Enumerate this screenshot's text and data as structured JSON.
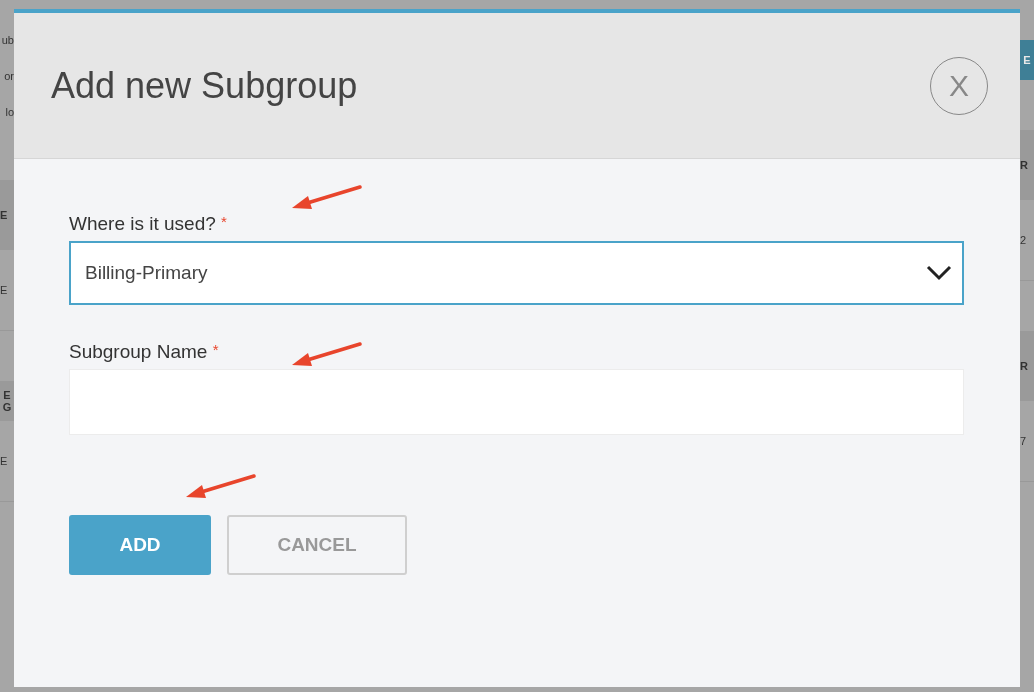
{
  "background": {
    "left_fragments": [
      {
        "text": "ub",
        "kind": "line"
      },
      {
        "text": "or",
        "kind": "line"
      },
      {
        "text": "lo",
        "kind": "line"
      },
      {
        "text": "E",
        "kind": "header"
      },
      {
        "text": "E",
        "kind": "cell"
      },
      {
        "text": "E",
        "kind": "header"
      },
      {
        "text": "G",
        "kind": "header_line"
      },
      {
        "text": "E",
        "kind": "cell"
      }
    ],
    "right_fragments": [
      {
        "text": "E",
        "kind": "button"
      },
      {
        "text": "R",
        "kind": "header"
      },
      {
        "text": "2",
        "kind": "cell"
      },
      {
        "text": "R",
        "kind": "header"
      },
      {
        "text": "7",
        "kind": "cell"
      }
    ]
  },
  "dialog": {
    "title": "Add new Subgroup",
    "close_label": "X",
    "fields": [
      {
        "kind": "select",
        "label": "Where is it used?",
        "required_mark": "*",
        "value": "Billing-Primary",
        "focused": true
      },
      {
        "kind": "text",
        "label": "Subgroup Name",
        "required_mark": "*",
        "focused": false
      }
    ],
    "buttons": [
      {
        "label": "ADD",
        "kind": "primary"
      },
      {
        "label": "CANCEL",
        "kind": "secondary"
      }
    ]
  }
}
